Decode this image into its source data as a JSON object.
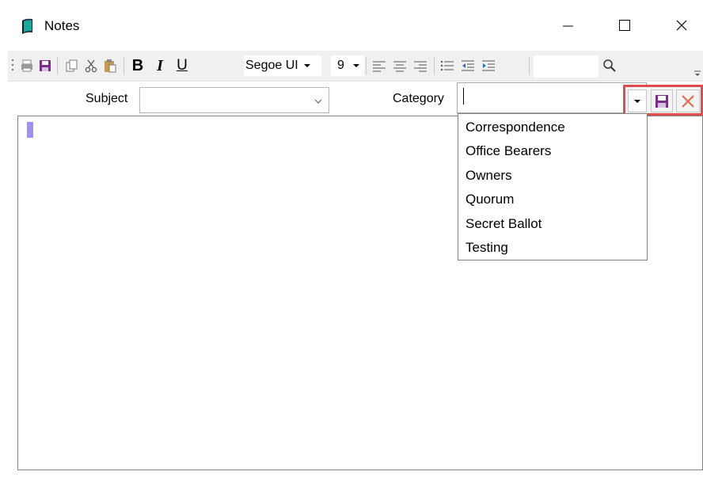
{
  "window": {
    "title": "Notes",
    "controls": {
      "minimize": "—",
      "maximize": "☐",
      "close": "✕"
    }
  },
  "toolbar": {
    "font_name": "Segoe UI",
    "font_size": "9",
    "bold": "B",
    "italic": "I",
    "underline": "U",
    "search_placeholder": ""
  },
  "fields": {
    "subject": {
      "label": "Subject",
      "value": ""
    },
    "category": {
      "label": "Category",
      "value": ""
    }
  },
  "category_options": [
    "Correspondence",
    "Office Bearers",
    "Owners",
    "Quorum",
    "Secret Ballot",
    "Testing"
  ],
  "colors": {
    "highlight_border": "#e24c4c",
    "cursor": "#9d93ee",
    "save_icon": "#7b2d8e",
    "cancel_icon": "#e07050"
  }
}
